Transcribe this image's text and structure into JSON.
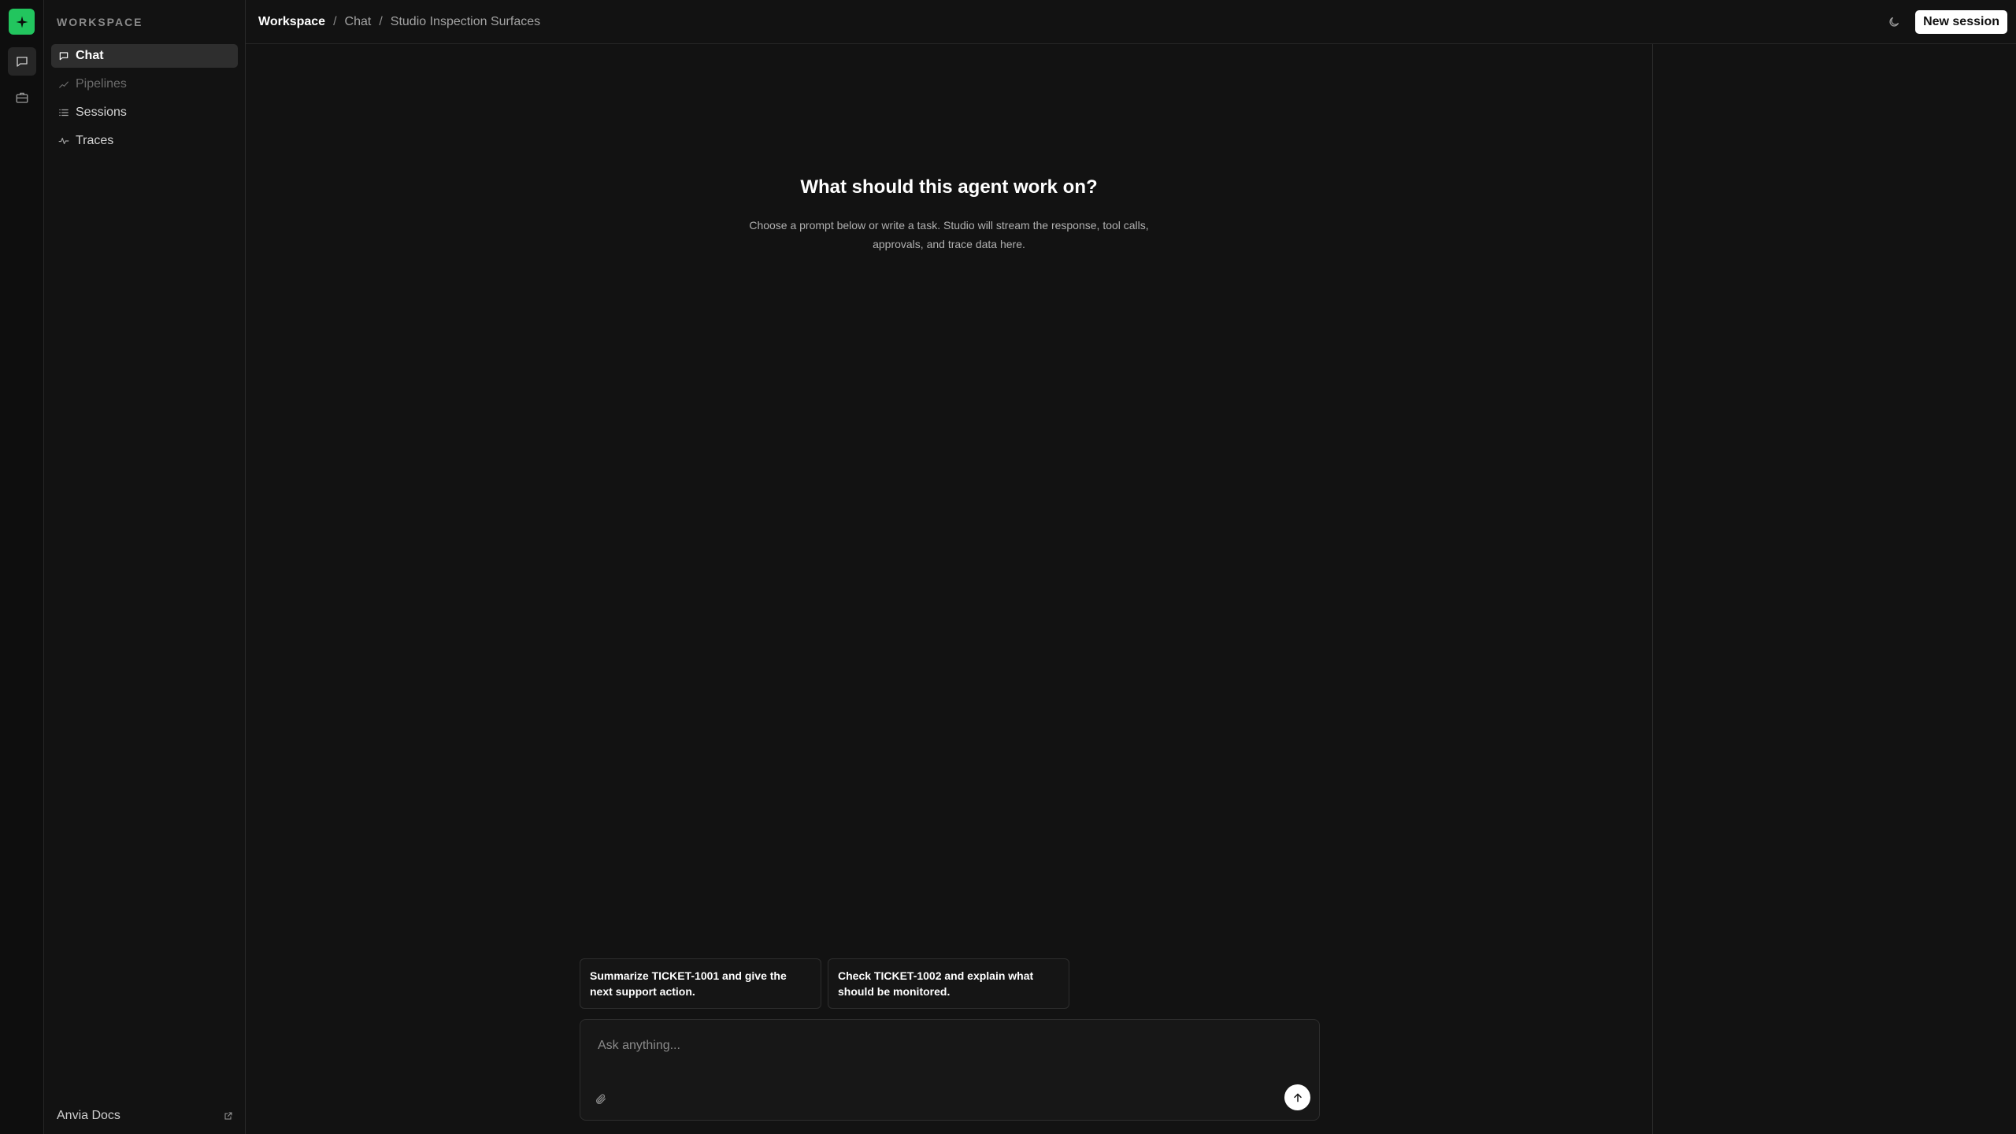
{
  "colors": {
    "accent": "#22c55e",
    "background": "#121212",
    "rail_background": "#0e0e0e",
    "primary_button_bg": "#ffffff"
  },
  "rail": {
    "logo_icon": "sparkle-icon",
    "items": [
      {
        "icon": "chat-icon",
        "active": true
      },
      {
        "icon": "briefcase-icon",
        "active": false
      }
    ]
  },
  "sidebar": {
    "section_label": "WORKSPACE",
    "items": [
      {
        "label": "Chat",
        "icon": "message-icon",
        "active": true
      },
      {
        "label": "Pipelines",
        "icon": "pipeline-icon",
        "dimmed": true
      },
      {
        "label": "Sessions",
        "icon": "list-icon"
      },
      {
        "label": "Traces",
        "icon": "activity-icon"
      }
    ],
    "footer": {
      "label": "Anvia Docs",
      "icon": "external-link-icon"
    }
  },
  "header": {
    "breadcrumb": [
      "Workspace",
      "Chat",
      "Studio Inspection Surfaces"
    ],
    "separator": "/",
    "theme_icon": "moon-icon",
    "new_session_label": "New session"
  },
  "main": {
    "title": "What should this agent work on?",
    "subtitle": "Choose a prompt below or write a task. Studio will stream the response, tool calls, approvals, and trace data here.",
    "suggestions": [
      "Summarize TICKET-1001 and give the next support action.",
      "Check TICKET-1002 and explain what should be monitored."
    ],
    "composer": {
      "placeholder": "Ask anything...",
      "value": "",
      "attach_icon": "paperclip-icon",
      "send_icon": "arrow-up-icon"
    }
  }
}
